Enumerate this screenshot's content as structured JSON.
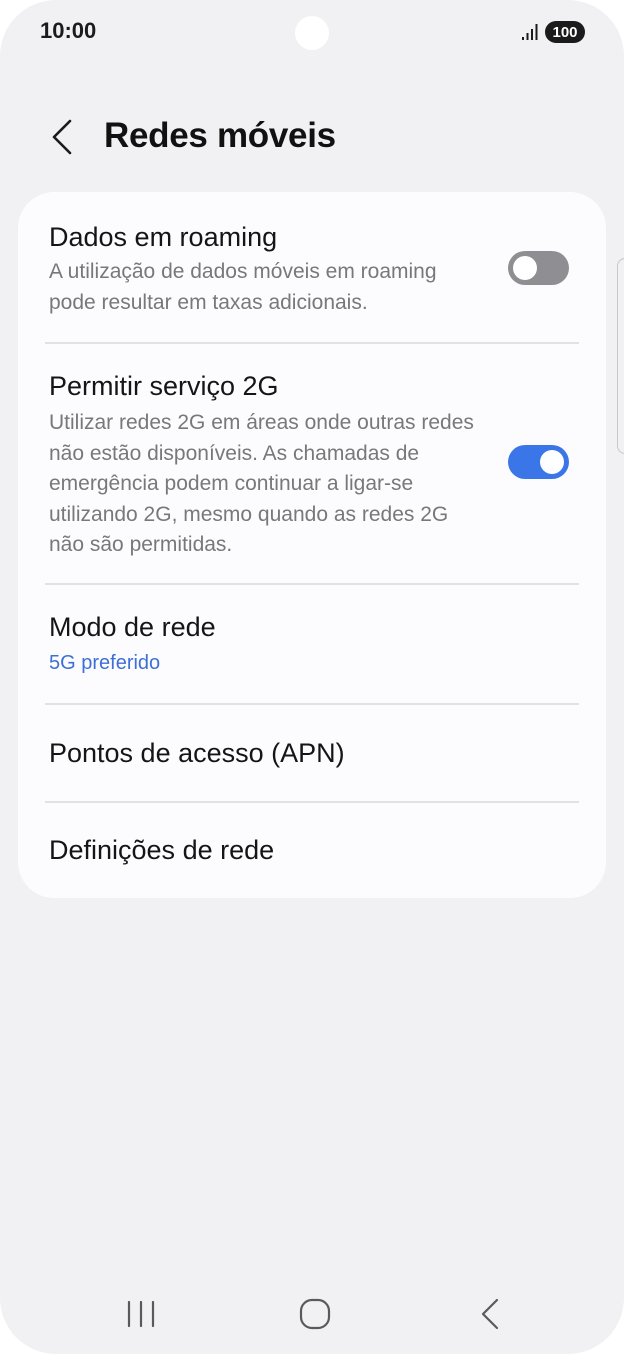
{
  "status_bar": {
    "time": "10:00",
    "battery": "100",
    "icons": [
      "signal-icon",
      "battery-icon"
    ]
  },
  "header": {
    "back_icon": "chevron-left-icon",
    "title": "Redes móveis"
  },
  "settings": [
    {
      "title": "Dados em roaming",
      "description": "A utilização de dados móveis em roaming pode resultar em taxas adicionais.",
      "toggle": false
    },
    {
      "title": "Permitir serviço 2G",
      "description": "Utilizar redes 2G em áreas onde outras redes não estão disponíveis. As chamadas de emergência podem continuar a ligar-se utilizando 2G, mesmo quando as redes 2G não são permitidas.",
      "toggle": true
    },
    {
      "title": "Modo de rede",
      "subtitle": "5G preferido"
    },
    {
      "title": "Pontos de acesso (APN)"
    },
    {
      "title": "Definições de rede"
    }
  ],
  "nav_bar": {
    "icons": [
      "recents-icon",
      "home-icon",
      "back-icon"
    ]
  },
  "colors": {
    "background": "#f1f1f3",
    "card": "#fcfcfe",
    "accent": "#3b76e8",
    "link": "#3d6fd6",
    "toggle_off": "#8e8e93"
  }
}
